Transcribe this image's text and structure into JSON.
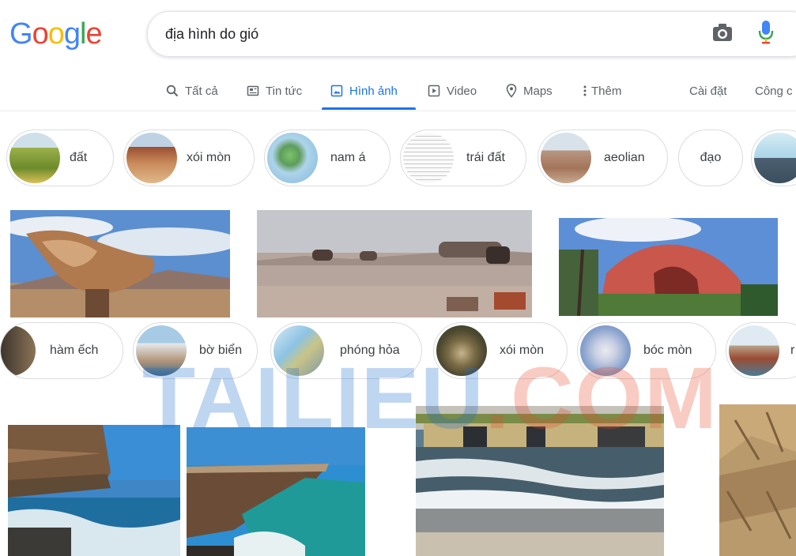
{
  "logo": {
    "letters": [
      {
        "ch": "G",
        "color": "#4285f4"
      },
      {
        "ch": "o",
        "color": "#ea4335"
      },
      {
        "ch": "o",
        "color": "#fbbc05"
      },
      {
        "ch": "g",
        "color": "#4285f4"
      },
      {
        "ch": "l",
        "color": "#34a853"
      },
      {
        "ch": "e",
        "color": "#ea4335"
      }
    ]
  },
  "search": {
    "query": "địa hình do gió"
  },
  "tabs": {
    "all": "Tất cả",
    "news": "Tin tức",
    "images": "Hình ảnh",
    "video": "Video",
    "maps": "Maps",
    "more": "Thêm",
    "settings": "Cài đặt",
    "tools": "Công c"
  },
  "chips_row1": [
    "đất",
    "xói mòn",
    "nam á",
    "trái đất",
    "aeolian",
    "đạo"
  ],
  "chips_row2": [
    "hàm ếch",
    "bờ biển",
    "phóng hỏa",
    "xói mòn",
    "bóc mòn",
    "r"
  ],
  "watermark": {
    "part1": "TAILIEU",
    "part2": ".COM"
  },
  "colors": {
    "accent": "#1a73e8",
    "muted": "#5f6368",
    "border": "#dfe1e5"
  }
}
